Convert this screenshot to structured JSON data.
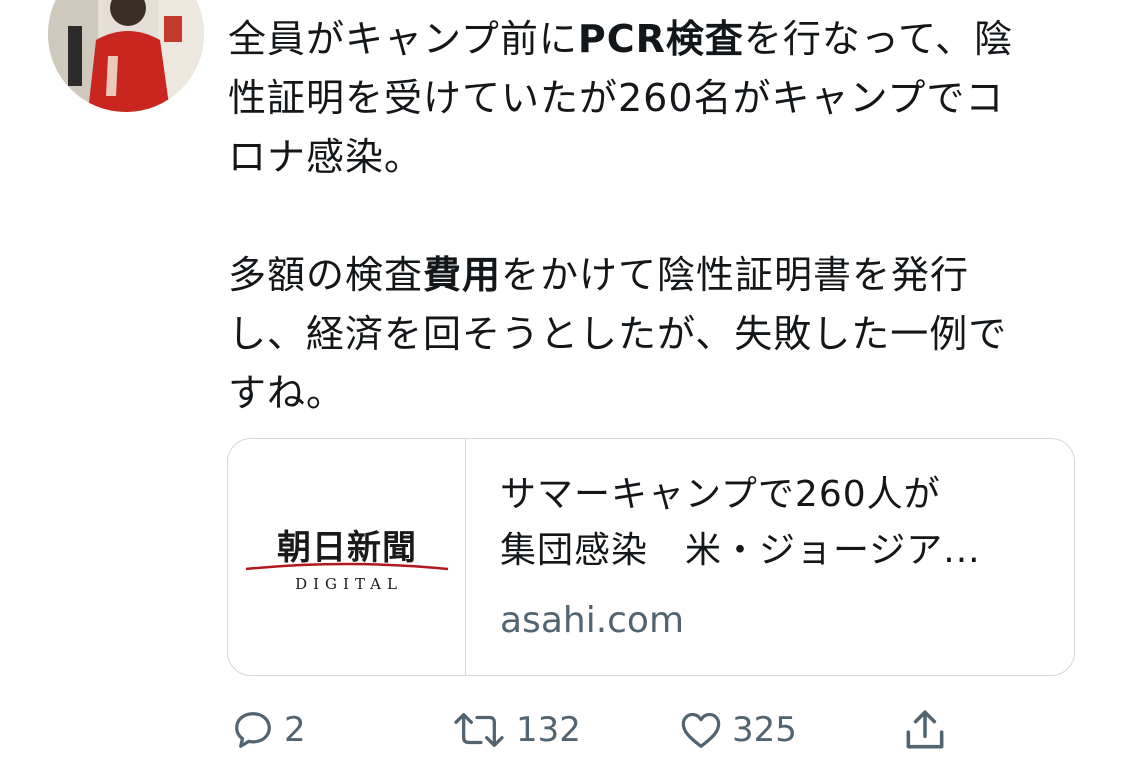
{
  "tweet": {
    "line1_a": "全員がキャンプ前に",
    "line1_bold": "PCR検査",
    "line1_b": "を行なって、陰",
    "line2": "性証明を受けていたが260名がキャンプでコ",
    "line3": "ロナ感染。",
    "line4_a": "多額の検査",
    "line4_bold": "費用",
    "line4_b": "をかけて陰性証明書を発行",
    "line5": "し、経済を回そうとしたが、失敗した一例で",
    "line6": "すね。"
  },
  "link_card": {
    "logo_text": "朝日新聞",
    "logo_sub": "DIGITAL",
    "title_line1": "サマーキャンプで260人が",
    "title_line2": "集団感染　米・ジョージア...",
    "domain": "asahi.com"
  },
  "actions": {
    "reply_count": "2",
    "retweet_count": "132",
    "like_count": "325"
  },
  "icons": {
    "reply": "reply-icon",
    "retweet": "retweet-icon",
    "like": "heart-icon",
    "share": "share-icon"
  },
  "colors": {
    "text": "#14171a",
    "secondary": "#536471",
    "border": "#cfd9de",
    "logo_red": "#b0191e"
  }
}
